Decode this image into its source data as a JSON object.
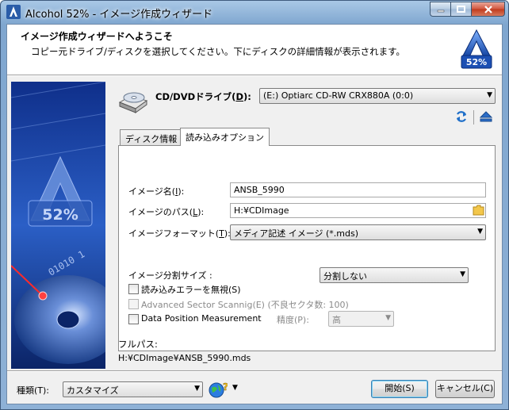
{
  "window": {
    "title": "Alcohol 52% - イメージ作成ウィザード"
  },
  "header": {
    "title": "イメージ作成ウィザードへようこそ",
    "subtitle": "コピー元ドライブ/ディスクを選択してください。下にディスクの詳細情報が表示されます。",
    "logo_text": "52%"
  },
  "drive": {
    "label_pre": "CD/DVDドライブ(",
    "label_key": "D",
    "label_post": "):",
    "selected": "(E:) Optiarc CD-RW CRX880A (0:0)"
  },
  "tabs": [
    {
      "label": "ディスク情報",
      "active": false
    },
    {
      "label": "読み込みオプション",
      "active": true
    }
  ],
  "options": {
    "image_name_label": "イメージ名(",
    "image_name_key": "I",
    "image_name_label_post": "):",
    "image_name_value": "ANSB_5990",
    "image_path_label": "イメージのパス(",
    "image_path_key": "L",
    "image_path_label_post": "):",
    "image_path_value": "H:¥CDImage",
    "image_format_label": "イメージフォーマット(",
    "image_format_key": "T",
    "image_format_label_post": "):",
    "image_format_value": "メディア記述 イメージ (*.mds)",
    "split_label": "イメージ分割サイズ :",
    "split_value": "分割しない",
    "ignore_errors_label": "読み込みエラーを無視(S)",
    "ignore_errors_checked": false,
    "advanced_sector_label": "Advanced Sector Scannig(E)  (不良セクタ数: 100)",
    "advanced_sector_enabled": false,
    "dpm_label": "Data Position Measurement",
    "dpm_checked": false,
    "precision_label": "精度(P):",
    "precision_value": "高"
  },
  "full_path": {
    "label": "フルパス:",
    "value": "H:¥CDImage¥ANSB_5990.mds"
  },
  "footer": {
    "type_label": "種類(T):",
    "type_value": "カスタマイズ",
    "start_button": "開始(S)",
    "cancel_button": "キャンセル(C)"
  },
  "side_banner": {
    "text": "52%",
    "binary": "01010 1"
  }
}
